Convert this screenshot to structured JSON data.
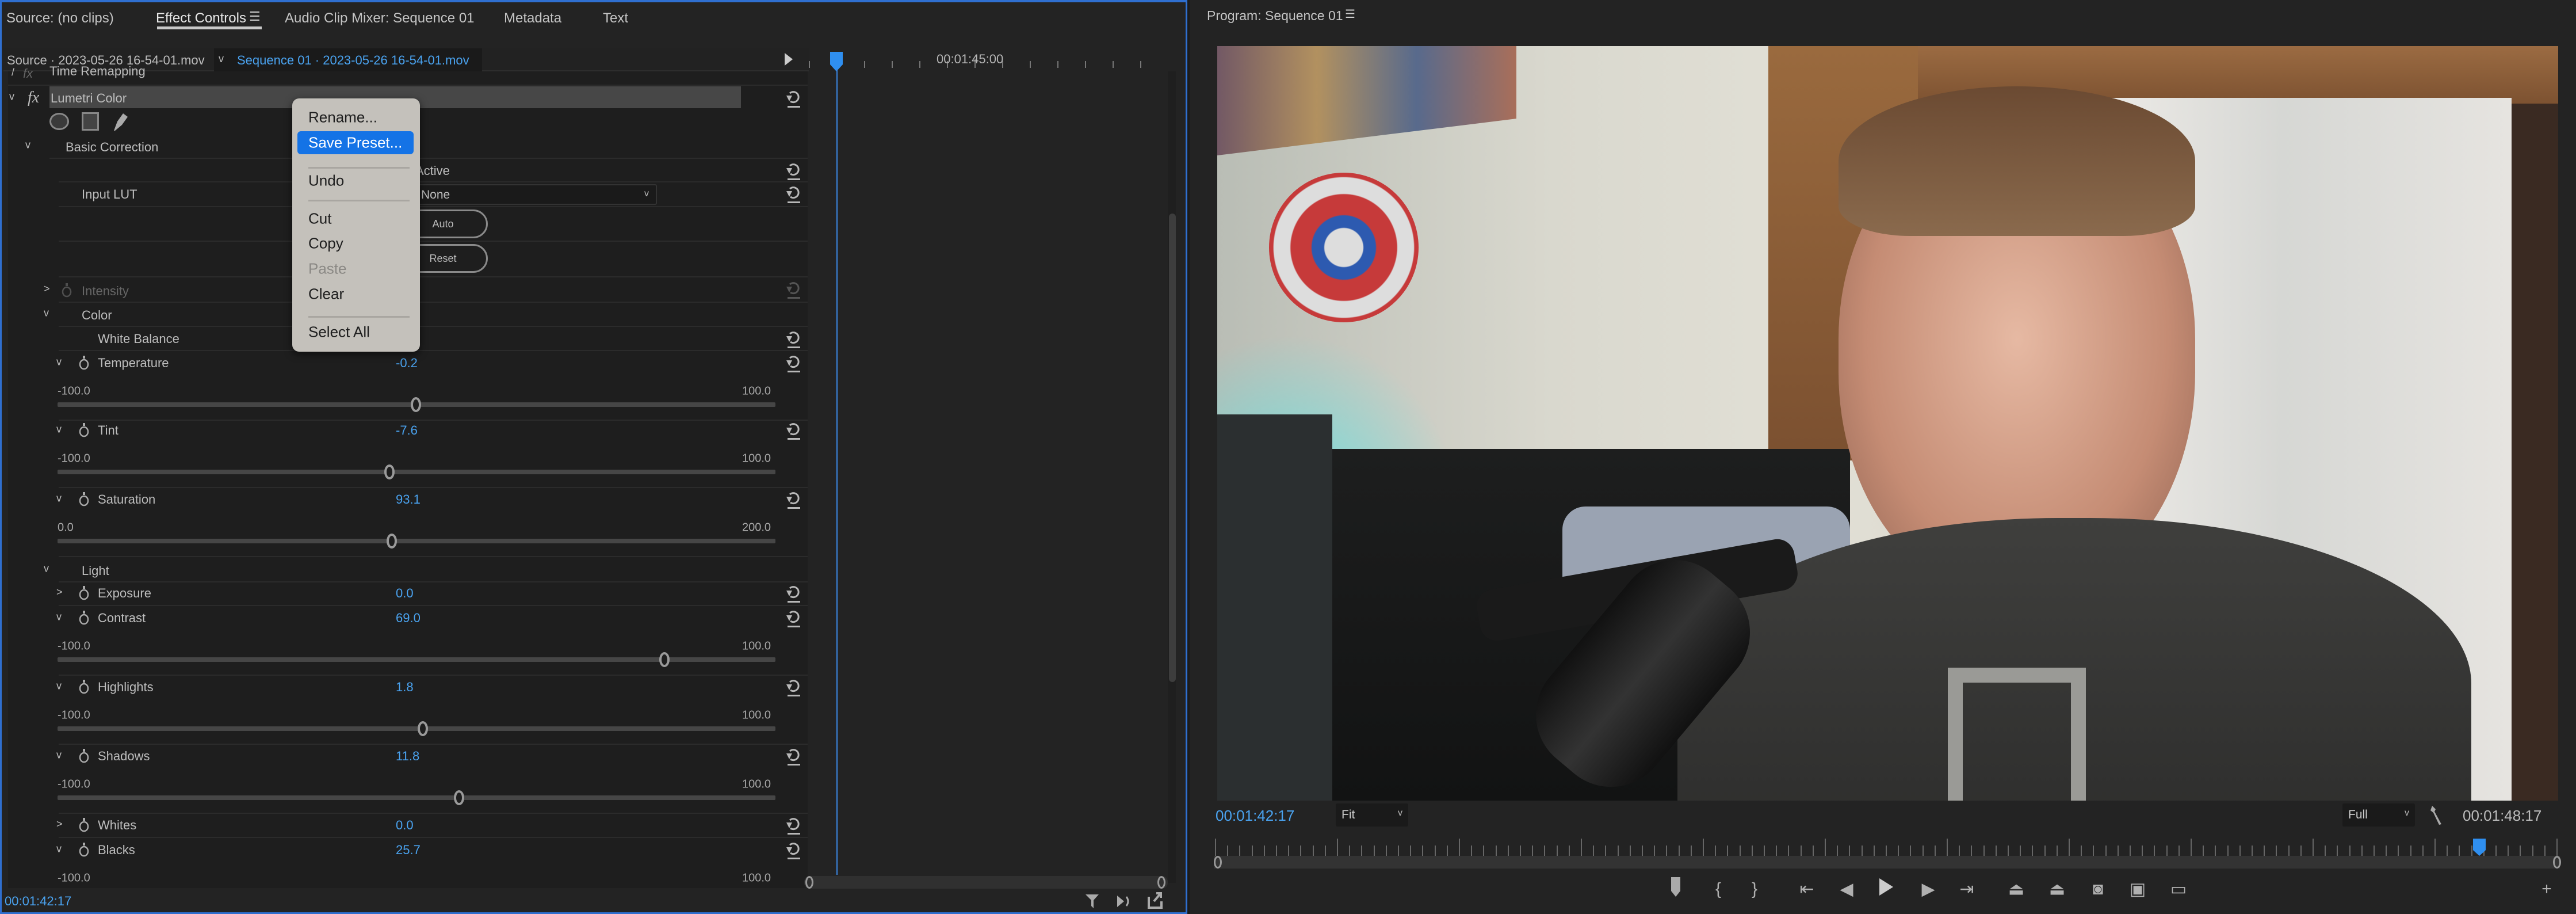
{
  "left_panel": {
    "tabs": [
      {
        "label": "Source: (no clips)"
      },
      {
        "label": "Effect Controls",
        "active": true
      },
      {
        "label": "Audio Clip Mixer: Sequence 01"
      },
      {
        "label": "Metadata"
      },
      {
        "label": "Text"
      }
    ],
    "menu_icon": "hamburger-icon",
    "source_clip": "Source · 2023-05-26 16-54-01.mov",
    "sequence_clip": "Sequence 01 · 2023-05-26 16-54-01.mov",
    "effects": {
      "time_remapping": "Time Remapping",
      "lumetri": "Lumetri Color",
      "basic_correction": "Basic Correction",
      "active_label": "Active",
      "input_lut_label": "Input LUT",
      "input_lut_value": "None",
      "auto_button": "Auto",
      "reset_button": "Reset",
      "intensity": "Intensity",
      "color": "Color",
      "white_balance": "White Balance",
      "light": "Light"
    },
    "params": [
      {
        "label": "Temperature",
        "value": "-0.2",
        "min": "-100.0",
        "max": "100.0",
        "expanded": true
      },
      {
        "label": "Tint",
        "value": "-7.6",
        "min": "-100.0",
        "max": "100.0",
        "expanded": true
      },
      {
        "label": "Saturation",
        "value": "93.1",
        "min": "0.0",
        "max": "200.0",
        "expanded": true
      },
      {
        "label": "Exposure",
        "value": "0.0",
        "expanded": false
      },
      {
        "label": "Contrast",
        "value": "69.0",
        "min": "-100.0",
        "max": "100.0",
        "expanded": true
      },
      {
        "label": "Highlights",
        "value": "1.8",
        "min": "-100.0",
        "max": "100.0",
        "expanded": true
      },
      {
        "label": "Shadows",
        "value": "11.8",
        "min": "-100.0",
        "max": "100.0",
        "expanded": true
      },
      {
        "label": "Whites",
        "value": "0.0",
        "expanded": false
      },
      {
        "label": "Blacks",
        "value": "25.7",
        "min": "-100.0",
        "max": "100.0",
        "expanded": true
      }
    ],
    "timeline_timecode": "00:01:45:00",
    "current_timecode": "00:01:42:17"
  },
  "context_menu": {
    "items": [
      {
        "label": "Rename..."
      },
      {
        "label": "Save Preset...",
        "highlighted": true
      },
      {
        "label": "Undo"
      },
      {
        "label": "Cut"
      },
      {
        "label": "Copy"
      },
      {
        "label": "Paste",
        "disabled": true
      },
      {
        "label": "Clear"
      },
      {
        "label": "Select All"
      }
    ]
  },
  "program_monitor": {
    "title": "Program: Sequence 01",
    "current_timecode": "00:01:42:17",
    "zoom": "Fit",
    "resolution": "Full",
    "duration": "00:01:48:17",
    "playhead_fraction": 0.94
  },
  "colors": {
    "accent": "#2f8ff0",
    "timecode": "#4aa3f0",
    "highlight": "#1473e6"
  }
}
